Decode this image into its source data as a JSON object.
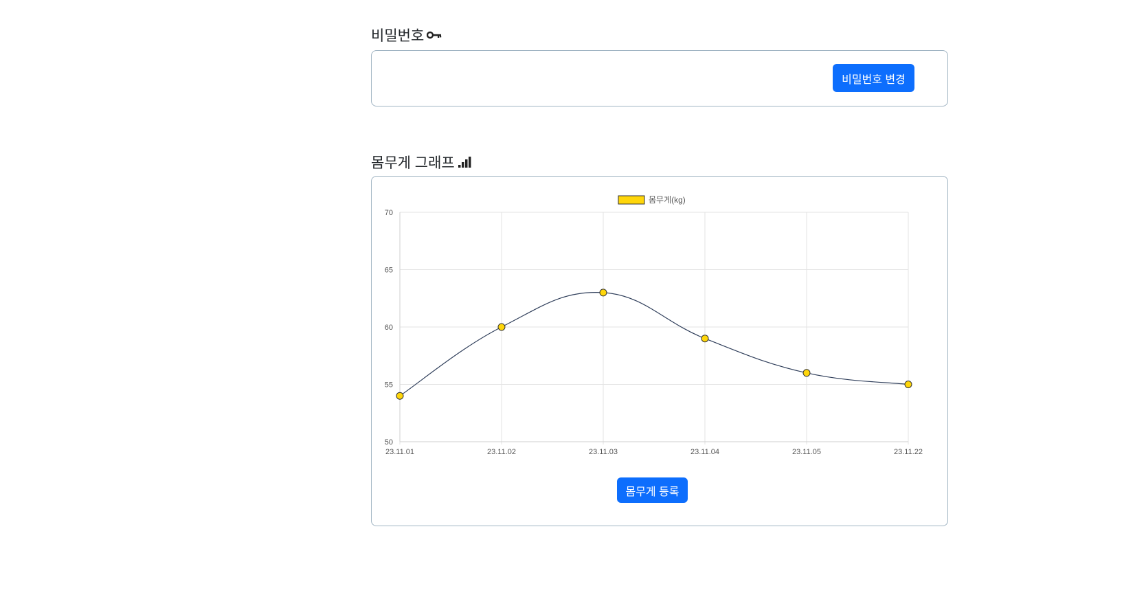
{
  "password_section": {
    "title": "비밀번호",
    "icon": "key-icon",
    "change_button_label": "비밀번호 변경"
  },
  "weight_section": {
    "title": "몸무게 그래프",
    "icon": "bar-chart-icon",
    "register_button_label": "몸무게 등록"
  },
  "colors": {
    "primary": "#0d6efd",
    "point_fill": "#ffd60a",
    "line": "#2f3e5a",
    "card_border": "#9fb3c2"
  },
  "chart_data": {
    "type": "line",
    "categories": [
      "23.11.01",
      "23.11.02",
      "23.11.03",
      "23.11.04",
      "23.11.05",
      "23.11.22"
    ],
    "series": [
      {
        "name": "몸무게(kg)",
        "values": [
          54,
          60,
          63,
          59,
          56,
          55
        ]
      }
    ],
    "ylim": [
      50,
      70
    ],
    "yticks": [
      50,
      55,
      60,
      65,
      70
    ],
    "grid": true,
    "legend": "top-center"
  }
}
